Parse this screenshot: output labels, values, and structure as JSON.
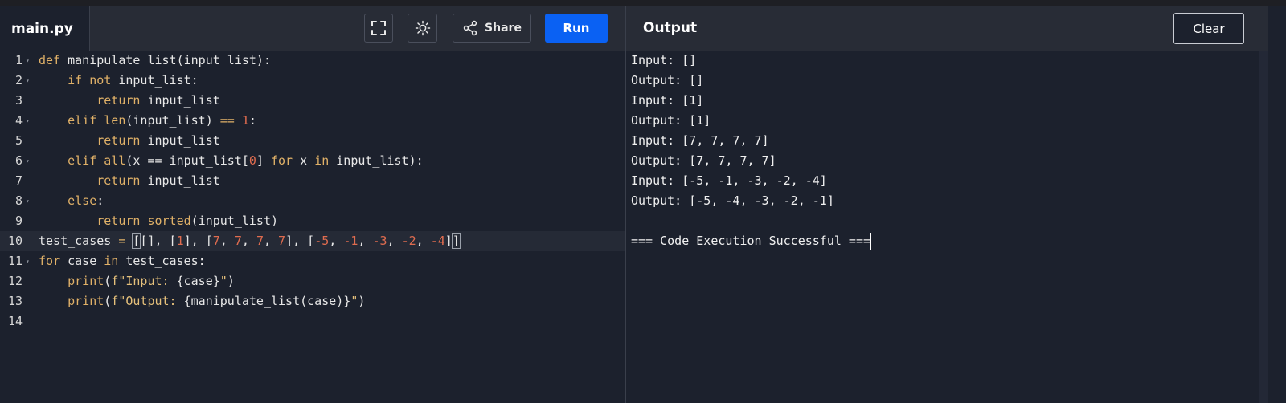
{
  "file_tab": {
    "label": "main.py"
  },
  "toolbar": {
    "fullscreen_icon": "fullscreen-icon",
    "theme_icon": "sun-icon",
    "share_icon": "share-icon",
    "share_label": "Share",
    "run_label": "Run"
  },
  "output_panel": {
    "title": "Output",
    "clear_label": "Clear",
    "lines": [
      "Input: []",
      "Output: []",
      "Input: [1]",
      "Output: [1]",
      "Input: [7, 7, 7, 7]",
      "Output: [7, 7, 7, 7]",
      "Input: [-5, -1, -3, -2, -4]",
      "Output: [-5, -4, -3, -2, -1]",
      "",
      "=== Code Execution Successful ==="
    ]
  },
  "editor": {
    "active_line": 10,
    "lines": [
      {
        "n": "1",
        "fold": true,
        "tokens": [
          [
            "kw",
            "def"
          ],
          [
            "t",
            " manipulate_list(input_list):"
          ]
        ]
      },
      {
        "n": "2",
        "fold": true,
        "tokens": [
          [
            "t",
            "    "
          ],
          [
            "kw",
            "if not"
          ],
          [
            "t",
            " input_list:"
          ]
        ]
      },
      {
        "n": "3",
        "fold": false,
        "tokens": [
          [
            "t",
            "        "
          ],
          [
            "kw",
            "return"
          ],
          [
            "t",
            " input_list"
          ]
        ]
      },
      {
        "n": "4",
        "fold": true,
        "tokens": [
          [
            "t",
            "    "
          ],
          [
            "kw",
            "elif"
          ],
          [
            "t",
            " "
          ],
          [
            "kw",
            "len"
          ],
          [
            "t",
            "(input_list) "
          ],
          [
            "kw",
            "=="
          ],
          [
            "t",
            " "
          ],
          [
            "num",
            "1"
          ],
          [
            "t",
            ":"
          ]
        ]
      },
      {
        "n": "5",
        "fold": false,
        "tokens": [
          [
            "t",
            "        "
          ],
          [
            "kw",
            "return"
          ],
          [
            "t",
            " input_list"
          ]
        ]
      },
      {
        "n": "6",
        "fold": true,
        "tokens": [
          [
            "t",
            "    "
          ],
          [
            "kw",
            "elif"
          ],
          [
            "t",
            " "
          ],
          [
            "kw",
            "all"
          ],
          [
            "t",
            "(x == input_list["
          ],
          [
            "num",
            "0"
          ],
          [
            "t",
            "] "
          ],
          [
            "kw",
            "for"
          ],
          [
            "t",
            " x "
          ],
          [
            "kw",
            "in"
          ],
          [
            "t",
            " input_list):"
          ]
        ]
      },
      {
        "n": "7",
        "fold": false,
        "tokens": [
          [
            "t",
            "        "
          ],
          [
            "kw",
            "return"
          ],
          [
            "t",
            " input_list"
          ]
        ]
      },
      {
        "n": "8",
        "fold": true,
        "tokens": [
          [
            "t",
            "    "
          ],
          [
            "kw",
            "else"
          ],
          [
            "t",
            ":"
          ]
        ]
      },
      {
        "n": "9",
        "fold": false,
        "tokens": [
          [
            "t",
            "        "
          ],
          [
            "kw",
            "return"
          ],
          [
            "t",
            " "
          ],
          [
            "kw",
            "sorted"
          ],
          [
            "t",
            "(input_list)"
          ]
        ]
      },
      {
        "n": "10",
        "fold": false,
        "tokens": [
          [
            "t",
            "test_cases "
          ],
          [
            "kw",
            "="
          ],
          [
            "t",
            " "
          ],
          [
            "br",
            "["
          ],
          [
            "t",
            "[], ["
          ],
          [
            "num",
            "1"
          ],
          [
            "t",
            "], ["
          ],
          [
            "num",
            "7"
          ],
          [
            "t",
            ", "
          ],
          [
            "num",
            "7"
          ],
          [
            "t",
            ", "
          ],
          [
            "num",
            "7"
          ],
          [
            "t",
            ", "
          ],
          [
            "num",
            "7"
          ],
          [
            "t",
            "], ["
          ],
          [
            "num",
            "-5"
          ],
          [
            "t",
            ", "
          ],
          [
            "num",
            "-1"
          ],
          [
            "t",
            ", "
          ],
          [
            "num",
            "-3"
          ],
          [
            "t",
            ", "
          ],
          [
            "num",
            "-2"
          ],
          [
            "t",
            ", "
          ],
          [
            "num",
            "-4"
          ],
          [
            "t",
            "]"
          ],
          [
            "br",
            "]"
          ]
        ]
      },
      {
        "n": "11",
        "fold": true,
        "tokens": [
          [
            "kw",
            "for"
          ],
          [
            "t",
            " case "
          ],
          [
            "kw",
            "in"
          ],
          [
            "t",
            " test_cases:"
          ]
        ]
      },
      {
        "n": "12",
        "fold": false,
        "tokens": [
          [
            "t",
            "    "
          ],
          [
            "kw",
            "print"
          ],
          [
            "t",
            "("
          ],
          [
            "str",
            "f\"Input: "
          ],
          [
            "t",
            "{case}"
          ],
          [
            "str",
            "\""
          ],
          [
            "t",
            ")"
          ]
        ]
      },
      {
        "n": "13",
        "fold": false,
        "tokens": [
          [
            "t",
            "    "
          ],
          [
            "kw",
            "print"
          ],
          [
            "t",
            "("
          ],
          [
            "str",
            "f\"Output: "
          ],
          [
            "t",
            "{manipulate_list(case)}"
          ],
          [
            "str",
            "\""
          ],
          [
            "t",
            ")"
          ]
        ]
      },
      {
        "n": "14",
        "fold": false,
        "tokens": []
      }
    ]
  }
}
